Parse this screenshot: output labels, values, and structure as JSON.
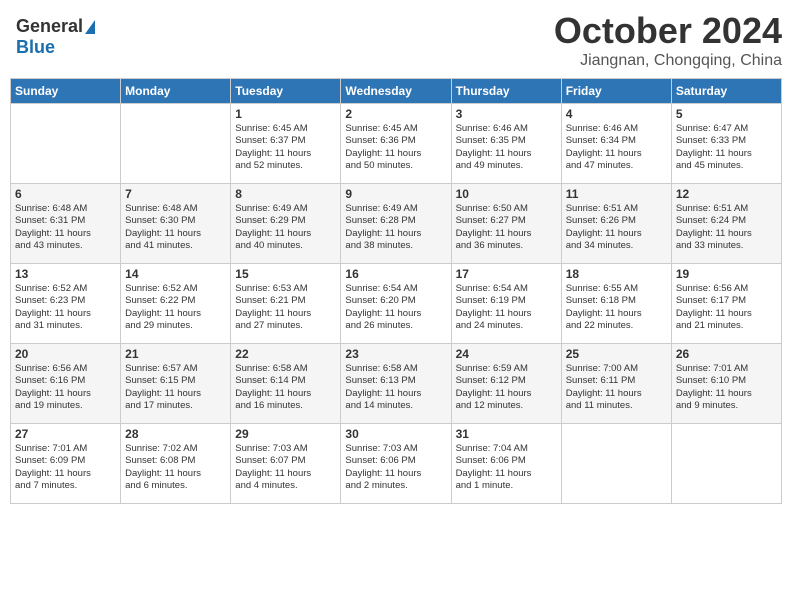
{
  "header": {
    "logo_general": "General",
    "logo_blue": "Blue",
    "month": "October 2024",
    "location": "Jiangnan, Chongqing, China"
  },
  "weekdays": [
    "Sunday",
    "Monday",
    "Tuesday",
    "Wednesday",
    "Thursday",
    "Friday",
    "Saturday"
  ],
  "weeks": [
    [
      {
        "day": "",
        "info": ""
      },
      {
        "day": "",
        "info": ""
      },
      {
        "day": "1",
        "info": "Sunrise: 6:45 AM\nSunset: 6:37 PM\nDaylight: 11 hours\nand 52 minutes."
      },
      {
        "day": "2",
        "info": "Sunrise: 6:45 AM\nSunset: 6:36 PM\nDaylight: 11 hours\nand 50 minutes."
      },
      {
        "day": "3",
        "info": "Sunrise: 6:46 AM\nSunset: 6:35 PM\nDaylight: 11 hours\nand 49 minutes."
      },
      {
        "day": "4",
        "info": "Sunrise: 6:46 AM\nSunset: 6:34 PM\nDaylight: 11 hours\nand 47 minutes."
      },
      {
        "day": "5",
        "info": "Sunrise: 6:47 AM\nSunset: 6:33 PM\nDaylight: 11 hours\nand 45 minutes."
      }
    ],
    [
      {
        "day": "6",
        "info": "Sunrise: 6:48 AM\nSunset: 6:31 PM\nDaylight: 11 hours\nand 43 minutes."
      },
      {
        "day": "7",
        "info": "Sunrise: 6:48 AM\nSunset: 6:30 PM\nDaylight: 11 hours\nand 41 minutes."
      },
      {
        "day": "8",
        "info": "Sunrise: 6:49 AM\nSunset: 6:29 PM\nDaylight: 11 hours\nand 40 minutes."
      },
      {
        "day": "9",
        "info": "Sunrise: 6:49 AM\nSunset: 6:28 PM\nDaylight: 11 hours\nand 38 minutes."
      },
      {
        "day": "10",
        "info": "Sunrise: 6:50 AM\nSunset: 6:27 PM\nDaylight: 11 hours\nand 36 minutes."
      },
      {
        "day": "11",
        "info": "Sunrise: 6:51 AM\nSunset: 6:26 PM\nDaylight: 11 hours\nand 34 minutes."
      },
      {
        "day": "12",
        "info": "Sunrise: 6:51 AM\nSunset: 6:24 PM\nDaylight: 11 hours\nand 33 minutes."
      }
    ],
    [
      {
        "day": "13",
        "info": "Sunrise: 6:52 AM\nSunset: 6:23 PM\nDaylight: 11 hours\nand 31 minutes."
      },
      {
        "day": "14",
        "info": "Sunrise: 6:52 AM\nSunset: 6:22 PM\nDaylight: 11 hours\nand 29 minutes."
      },
      {
        "day": "15",
        "info": "Sunrise: 6:53 AM\nSunset: 6:21 PM\nDaylight: 11 hours\nand 27 minutes."
      },
      {
        "day": "16",
        "info": "Sunrise: 6:54 AM\nSunset: 6:20 PM\nDaylight: 11 hours\nand 26 minutes."
      },
      {
        "day": "17",
        "info": "Sunrise: 6:54 AM\nSunset: 6:19 PM\nDaylight: 11 hours\nand 24 minutes."
      },
      {
        "day": "18",
        "info": "Sunrise: 6:55 AM\nSunset: 6:18 PM\nDaylight: 11 hours\nand 22 minutes."
      },
      {
        "day": "19",
        "info": "Sunrise: 6:56 AM\nSunset: 6:17 PM\nDaylight: 11 hours\nand 21 minutes."
      }
    ],
    [
      {
        "day": "20",
        "info": "Sunrise: 6:56 AM\nSunset: 6:16 PM\nDaylight: 11 hours\nand 19 minutes."
      },
      {
        "day": "21",
        "info": "Sunrise: 6:57 AM\nSunset: 6:15 PM\nDaylight: 11 hours\nand 17 minutes."
      },
      {
        "day": "22",
        "info": "Sunrise: 6:58 AM\nSunset: 6:14 PM\nDaylight: 11 hours\nand 16 minutes."
      },
      {
        "day": "23",
        "info": "Sunrise: 6:58 AM\nSunset: 6:13 PM\nDaylight: 11 hours\nand 14 minutes."
      },
      {
        "day": "24",
        "info": "Sunrise: 6:59 AM\nSunset: 6:12 PM\nDaylight: 11 hours\nand 12 minutes."
      },
      {
        "day": "25",
        "info": "Sunrise: 7:00 AM\nSunset: 6:11 PM\nDaylight: 11 hours\nand 11 minutes."
      },
      {
        "day": "26",
        "info": "Sunrise: 7:01 AM\nSunset: 6:10 PM\nDaylight: 11 hours\nand 9 minutes."
      }
    ],
    [
      {
        "day": "27",
        "info": "Sunrise: 7:01 AM\nSunset: 6:09 PM\nDaylight: 11 hours\nand 7 minutes."
      },
      {
        "day": "28",
        "info": "Sunrise: 7:02 AM\nSunset: 6:08 PM\nDaylight: 11 hours\nand 6 minutes."
      },
      {
        "day": "29",
        "info": "Sunrise: 7:03 AM\nSunset: 6:07 PM\nDaylight: 11 hours\nand 4 minutes."
      },
      {
        "day": "30",
        "info": "Sunrise: 7:03 AM\nSunset: 6:06 PM\nDaylight: 11 hours\nand 2 minutes."
      },
      {
        "day": "31",
        "info": "Sunrise: 7:04 AM\nSunset: 6:06 PM\nDaylight: 11 hours\nand 1 minute."
      },
      {
        "day": "",
        "info": ""
      },
      {
        "day": "",
        "info": ""
      }
    ]
  ]
}
